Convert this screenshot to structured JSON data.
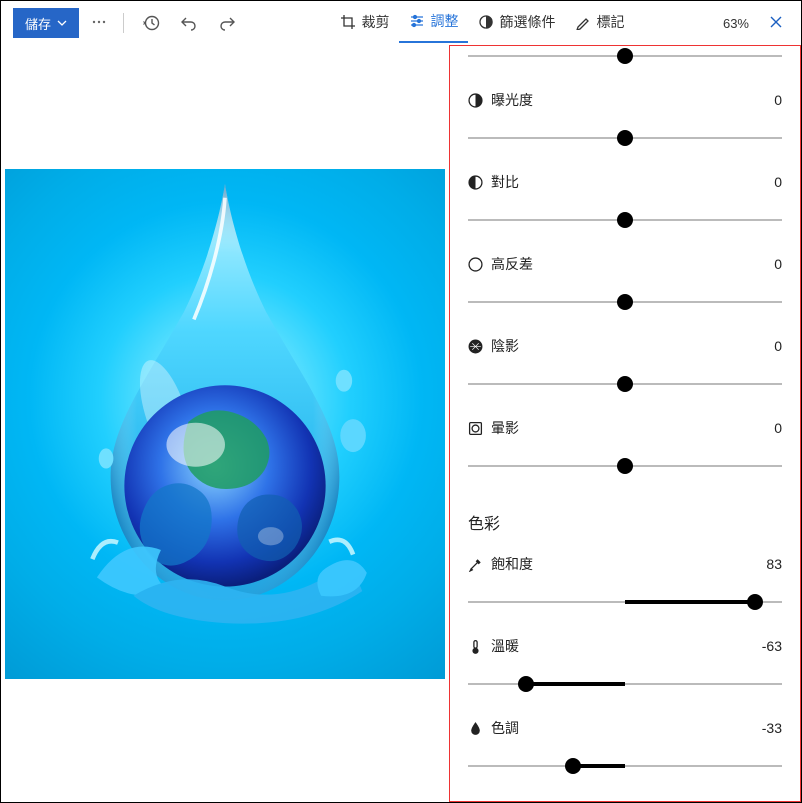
{
  "toolbar": {
    "save_label": "儲存",
    "zoom_label": "63%"
  },
  "tabs": {
    "crop": {
      "label": "裁剪"
    },
    "adjust": {
      "label": "調整"
    },
    "filter": {
      "label": "篩選條件"
    },
    "markup": {
      "label": "標記"
    }
  },
  "panel": {
    "top": {
      "value": 0,
      "pos": 50
    },
    "exposure": {
      "label": "曝光度",
      "value": 0,
      "pos": 50
    },
    "contrast": {
      "label": "對比",
      "value": 0,
      "pos": 50
    },
    "highlight": {
      "label": "高反差",
      "value": 0,
      "pos": 50
    },
    "shadow": {
      "label": "陰影",
      "value": 0,
      "pos": 50
    },
    "vignette": {
      "label": "暈影",
      "value": 0,
      "pos": 50
    },
    "section_color": "色彩",
    "saturation": {
      "label": "飽和度",
      "value": 83,
      "pos": 91.5
    },
    "warmth": {
      "label": "溫暖",
      "value": -63,
      "pos": 18.5
    },
    "tint": {
      "label": "色調",
      "value": -33,
      "pos": 33.5
    }
  }
}
